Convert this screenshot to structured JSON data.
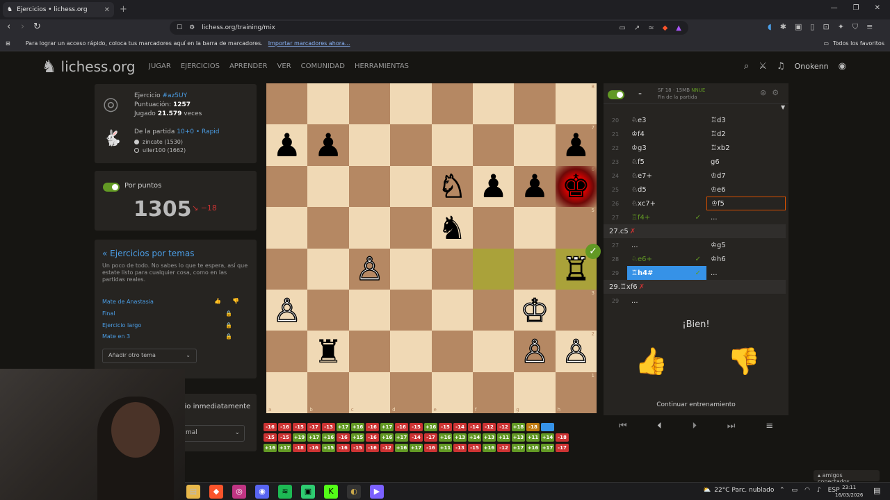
{
  "browser": {
    "tab_title": "Ejercicios • lichess.org",
    "url": "lichess.org/training/mix",
    "bookmarks_message": "Para lograr un acceso rápido, coloca tus marcadores aquí en la barra de marcadores.",
    "bookmarks_link": "Importar marcadores ahora...",
    "all_favorites": "Todos los favoritos"
  },
  "site": {
    "logo": "lichess.org",
    "nav": [
      "JUGAR",
      "EJERCICIOS",
      "APRENDER",
      "VER",
      "COMUNIDAD",
      "HERRAMIENTAS"
    ],
    "username": "Onokenn"
  },
  "puzzle_info": {
    "label": "Ejercicio",
    "id": "#az5UY",
    "rating_label": "Puntuación:",
    "rating": "1257",
    "played_label": "Jugado",
    "played_count": "21.579",
    "played_suffix": "veces",
    "game_label": "De la partida",
    "game_type": "10+0 • Rapid",
    "white_player": "zincate (1530)",
    "black_player": "uller100 (1662)"
  },
  "rating_panel": {
    "toggle_label": "Por puntos",
    "value": "1305",
    "diff": "−18"
  },
  "themes": {
    "title": "« Ejercicios por temas",
    "description": "Un poco de todo. No sabes lo que te espera, así que estate listo para cualquier cosa, como en las partidas reales.",
    "items": [
      "Mate de Anastasia",
      "Final",
      "Ejercicio largo",
      "Mate en 3"
    ],
    "add_label": "Añadir otro tema"
  },
  "options": {
    "jump_label": "cio inmediatamente",
    "select_value": "mal"
  },
  "ceval": {
    "dash": "-",
    "engine": "SF 18 · 15MB",
    "nnue": "NNUE",
    "status": "Fin de la partida"
  },
  "moves": [
    {
      "n": "20",
      "w": "♘e3",
      "b": "♖d3"
    },
    {
      "n": "21",
      "w": "♔f4",
      "b": "♖d2"
    },
    {
      "n": "22",
      "w": "♔g3",
      "b": "♖xb2"
    },
    {
      "n": "23",
      "w": "♘f5",
      "b": "g6"
    },
    {
      "n": "24",
      "w": "♘e7+",
      "b": "♔d7"
    },
    {
      "n": "25",
      "w": "♘d5",
      "b": "♔e6"
    },
    {
      "n": "26",
      "w": "♘xc7+",
      "b": "♔f5"
    },
    {
      "n": "27",
      "w": "♖f4+",
      "b": "..."
    }
  ],
  "variation1": "27.c5",
  "moves2": [
    {
      "n": "27",
      "w": "...",
      "b": "♔g5"
    },
    {
      "n": "28",
      "w": "♘e6+",
      "b": "♔h6"
    },
    {
      "n": "29",
      "w": "♖h4#",
      "b": "..."
    }
  ],
  "variation2": "29.♖xf6",
  "moves3": [
    {
      "n": "29",
      "w": "...",
      "b": ""
    }
  ],
  "feedback": {
    "text": "¡Bien!",
    "continue": "Continuar entrenamiento"
  },
  "history": [
    [
      "-16",
      "-16",
      "-15",
      "-17",
      "-13",
      "+17",
      "+16",
      "-16",
      "+17",
      "-16",
      "-15",
      "+16",
      "-15",
      "-14",
      "-14",
      "-12",
      "-12",
      "+18",
      "-18",
      ""
    ],
    [
      "-15",
      "-15",
      "+19",
      "+17",
      "+16",
      "-16",
      "+15",
      "-16",
      "+16",
      "+17",
      "-14",
      "-17",
      "+16",
      "+13",
      "+14",
      "+13",
      "+11",
      "+13",
      "+11",
      "+14",
      "-18"
    ],
    [
      "+16",
      "+17",
      "-18",
      "-16",
      "+15",
      "-16",
      "-15",
      "-16",
      "-12",
      "+16",
      "+17",
      "-16",
      "+11",
      "-13",
      "-15",
      "+16",
      "-12",
      "+17",
      "+16",
      "+17",
      "-17"
    ]
  ],
  "friends": "amigos conectados",
  "taskbar": {
    "weather": "22°C Parc. nublado",
    "lang": "ESP",
    "time": "23:11",
    "date": "16/03/2026"
  },
  "colors": {
    "green": "#629924",
    "red": "#cc3333",
    "blue": "#3692e7"
  }
}
